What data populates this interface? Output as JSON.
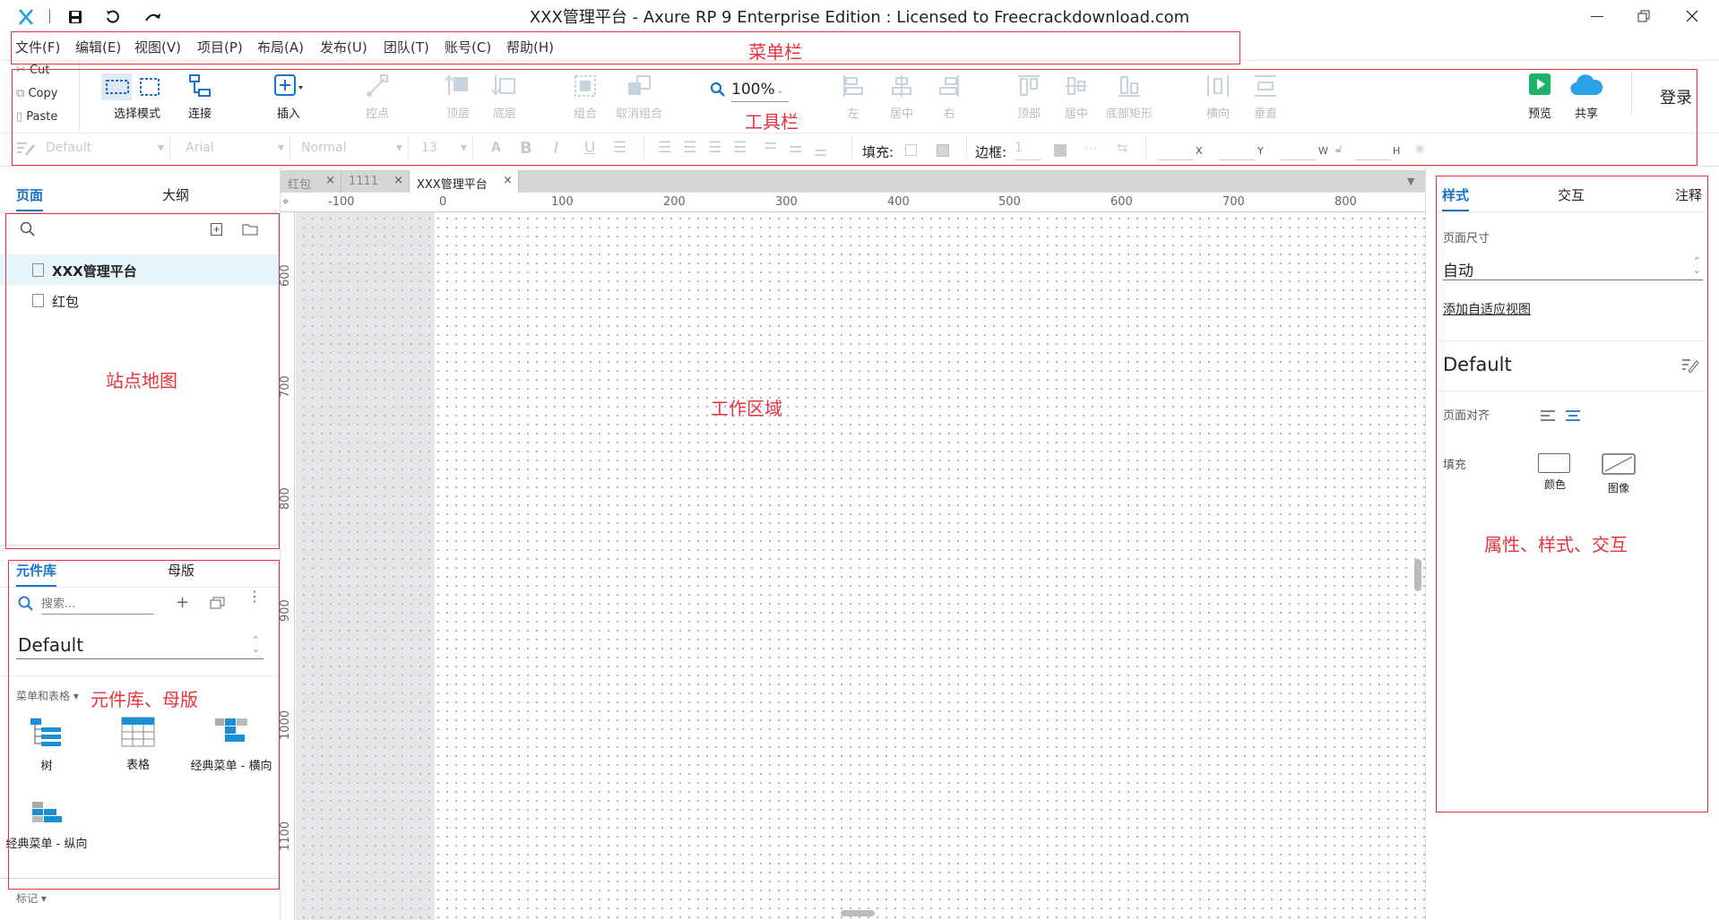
{
  "titlebar": {
    "title": "XXX管理平台 - Axure RP 9 Enterprise Edition : Licensed to Freecrackdownload.com",
    "icons": [
      "axure-logo-icon",
      "save-icon",
      "undo-icon",
      "redo-icon",
      "minimize-icon",
      "restore-icon",
      "close-icon"
    ]
  },
  "menu": [
    "文件(F)",
    "编辑(E)",
    "视图(V)",
    "项目(P)",
    "布局(A)",
    "发布(U)",
    "团队(T)",
    "账号(C)",
    "帮助(H)"
  ],
  "clipboard": {
    "cut": "Cut",
    "copy": "Copy",
    "paste": "Paste"
  },
  "toolbar": {
    "select_mode": "选择模式",
    "connect": "连接",
    "insert": "插入",
    "anchor": "控点",
    "top_layer": "顶层",
    "bottom_layer": "底层",
    "group": "组合",
    "ungroup": "取消组合",
    "zoom": "100%",
    "align_left": "左",
    "align_center": "居中",
    "align_right": "右",
    "align_top": "顶部",
    "align_middle": "居中",
    "align_bottom": "底部矩形",
    "dist_h": "横向",
    "dist_v": "垂直",
    "preview": "预览",
    "share": "共享",
    "login": "登录"
  },
  "format": {
    "style": "Default",
    "font": "Arial",
    "weight": "Normal",
    "size": "13",
    "fill_label": "填充:",
    "border_label": "边框:",
    "border_value": "1",
    "x": "X",
    "y": "Y",
    "w": "W",
    "h": "H"
  },
  "pages_panel": {
    "tabs": [
      "页面",
      "大纲"
    ],
    "pages": [
      "XXX管理平台",
      "红包"
    ]
  },
  "library_panel": {
    "tabs": [
      "元件库",
      "母版"
    ],
    "search_placeholder": "搜索...",
    "library": "Default",
    "category": "菜单和表格 ▾",
    "widgets": [
      "树",
      "表格",
      "经典菜单 - 横向",
      "经典菜单 - 纵向"
    ],
    "footer": "标记 ▾"
  },
  "doc_tabs": [
    "红包",
    "1111",
    "XXX管理平台"
  ],
  "ruler": {
    "top": [
      "-100",
      "0",
      "100",
      "200",
      "300",
      "400",
      "500",
      "600",
      "700",
      "800"
    ],
    "left": [
      "600",
      "700",
      "800",
      "900",
      "1000",
      "1100"
    ]
  },
  "inspector": {
    "tabs": [
      "样式",
      "交互",
      "注释"
    ],
    "page_size_label": "页面尺寸",
    "page_size": "自动",
    "adaptive_link": "添加自适应视图",
    "style_name": "Default",
    "page_align_label": "页面对齐",
    "fill_label": "填充",
    "fill_color": "颜色",
    "fill_image": "图像"
  },
  "annotations": {
    "menu": "菜单栏",
    "toolbar": "工具栏",
    "sitemap": "站点地图",
    "workspace": "工作区域",
    "library": "元件库、母版",
    "properties": "属性、样式、交互"
  },
  "colors": {
    "accent": "#1a73c9",
    "annotation": "#e8323c",
    "preview_green": "#1db36b",
    "share_blue": "#2aa0e8"
  }
}
